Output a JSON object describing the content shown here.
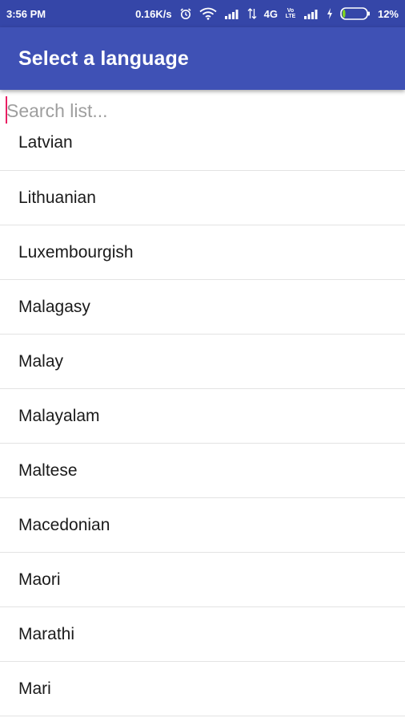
{
  "status_bar": {
    "time": "3:56 PM",
    "net_speed": "0.16K/s",
    "network_4g": "4G",
    "volte": "Vo LTE",
    "battery_percent": "12%",
    "battery_level": 0.12,
    "icons": [
      "alarm-icon",
      "wifi-icon",
      "signal-icon",
      "data-arrows-icon",
      "signal-icon",
      "charging-icon",
      "battery-icon"
    ]
  },
  "app_bar": {
    "title": "Select a language",
    "color": "#3f51b5"
  },
  "search": {
    "placeholder": "Search list...",
    "value": "",
    "caret_color": "#e91e63"
  },
  "languages": [
    "Latvian",
    "Lithuanian",
    "Luxembourgish",
    "Malagasy",
    "Malay",
    "Malayalam",
    "Maltese",
    "Macedonian",
    "Maori",
    "Marathi",
    "Mari"
  ]
}
